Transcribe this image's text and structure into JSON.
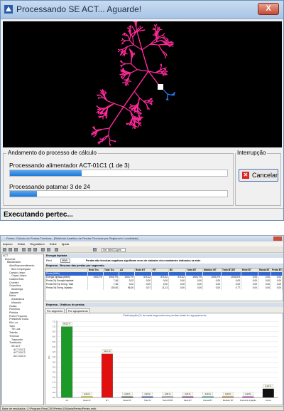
{
  "progress_dialog": {
    "title": "Processando SE ACT... Aguarde!",
    "close_glyph": "X",
    "group_label": "Andamento do processo de cálculo",
    "feeder_label": "Processando alimentador ACT-01C1 (1 de 3)",
    "feeder_progress": 0.33,
    "level_label": "Processando patamar 3 de 24",
    "level_progress": 0.125,
    "interrupt_label": "Interrupção",
    "cancel_label": "Cancelar",
    "status_text": "Executando pertec...",
    "network_colors": {
      "main": "#ff2b9a",
      "substation": "#ffffff",
      "branch": "#2f7fff"
    }
  },
  "main_window": {
    "title": "Pertec: Cálculo de Perdas Técnicas - [Relatório Analítico de Perdas Técnicas por Regional e Localidade]",
    "menu": [
      "Arquivo",
      "Editar",
      "Regulatório",
      "Exibir",
      "Ajuda"
    ],
    "toolbar_combo": "Sel: WinCCopes",
    "tree": [
      "ACT",
      "Empresa",
      "Bandeirante",
      "Alim/Empreendimento",
      "Bem Empregado",
      "Campo Limpo",
      "Capao Limpo",
      "Castelo Bolo",
      "Cruzeiro",
      "Guarulhos",
      "Alvarenga",
      "Jaguaré",
      "Mauá",
      "Aricanduva",
      "Mirandin",
      "Osaka",
      "Pinheiros",
      "Pirituba",
      "Ponte Pequena",
      "Presidente Dutra",
      "Rio Luz",
      "Tatuí",
      "Tiê Luiz",
      "Taboão",
      "Terminal",
      "Tramontin",
      "Treatitubal",
      "SE ACT",
      "ACT-01C1",
      "ACT-01C2",
      "ACT-01C3"
    ],
    "energy_panel": {
      "header": "Energia Injetada",
      "period_label": "Perd.",
      "period_value": "MWh"
    },
    "losses_note": "Perdas não técnicas negativas significam erros de cadastro e/ou montantes indicados na rede",
    "summary_table": {
      "header": "Empresa - Resumo das perdas por segmento",
      "columns": [
        "",
        "Rede Tec.",
        "Total Tec.",
        "A3",
        "Rede MT",
        "PIT",
        "BC",
        "Trafo MT",
        "Medidor MT",
        "Trafo MT-BT",
        "Rede BT",
        "Ramal BT",
        "Perda BT"
      ],
      "rows": [
        [
          "Perda (MWh)",
          "",
          "",
          "",
          "",
          "",
          "",
          "",
          "",
          "",
          "",
          "",
          ""
        ],
        [
          "Energia Injetada (MWh)",
          "1903,7%",
          "1903,7%",
          "1903,7%",
          "574,22",
          "574,22",
          "574,22",
          "1903,7%",
          "1903,7%",
          "1903,0%",
          "0,00",
          "0,00",
          "0,00"
        ],
        [
          "Perda (%) Energia Injetada",
          "",
          "7,46",
          "0,02",
          "0,00",
          "0,00",
          "0,00",
          "0,00",
          "0,00",
          "0,00",
          "0,00",
          "0,00",
          "0,00"
        ],
        [
          "Perda Ref.(%) Energ. Total",
          "",
          "7,46",
          "0,02",
          "0,00",
          "0,00",
          "0,00",
          "0,00",
          "0,00",
          "0,00",
          "0,00",
          "0,00",
          "0,00"
        ],
        [
          "Perda (%) Energ. Injetada",
          "",
          "100,00",
          "96,26",
          "0,07",
          "11,13",
          "0,00",
          "0,00",
          "0,00",
          "0,77",
          "0,00",
          "0,00",
          "0,00"
        ]
      ]
    },
    "chart_panel_header": "Empresa - Gráficos de perdas",
    "tabs": [
      "Por segmento",
      "Por agrupamento"
    ],
    "status_bar": "Base de resultados: C:\\Program Files\\CEE\\Pertec\\13\\Maria\\Pertec\\Pertec.mdb"
  },
  "chart_data": {
    "type": "bar",
    "title": "Participação (% de cada segmento nas perdas totais do agrupamento",
    "ylabel": "(%)",
    "ylim": [
      0,
      7.6
    ],
    "yticks": [
      0.0,
      0.5,
      1.0,
      1.5,
      2.0,
      2.5,
      3.0,
      3.5,
      4.0,
      4.5,
      5.0,
      5.5,
      6.0,
      6.5,
      7.0,
      7.5
    ],
    "categories": [
      "A3",
      "Rede AT",
      "MT",
      "Rede MT",
      "Trafo AT",
      "Trafo MT/BT",
      "Rede BT",
      "Ramal BT",
      "Medidor BT",
      "Ramal de Ligação",
      "Outros"
    ],
    "values": [
      6.99,
      0.0,
      4.3,
      0.0,
      0.0,
      0.0,
      0.0,
      0.0,
      0.0,
      0.0,
      0.85
    ],
    "data_labels": [
      "86,51 %",
      "0,00 %",
      "52,41 %",
      "0,00 %",
      "0,00 %",
      "0,00 %",
      "0,00 %",
      "0,00 %",
      "0,00 %",
      "0,00 %",
      "8,34 %"
    ],
    "colors": [
      "#1c9a28",
      "#e0e000",
      "#e01010",
      "#404040",
      "#2040c0",
      "#a0a0a0",
      "#9020a0",
      "#20c0c0",
      "#e08000",
      "#d020d0",
      "#111111"
    ],
    "grid": true
  }
}
